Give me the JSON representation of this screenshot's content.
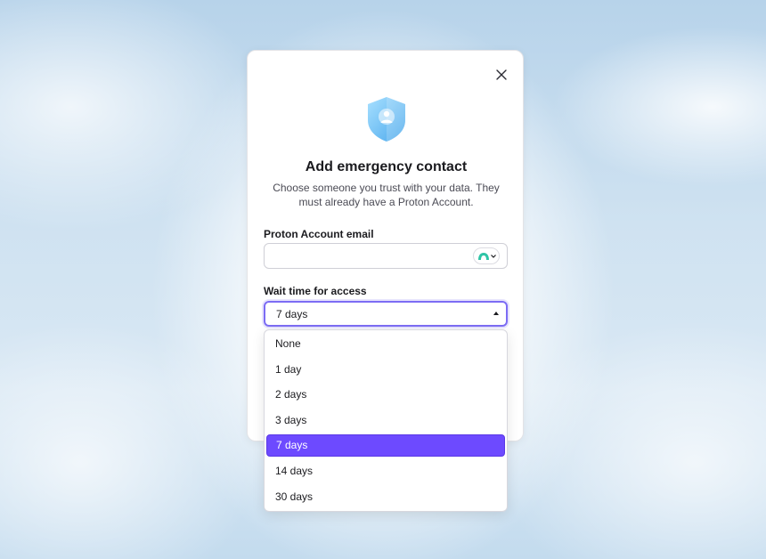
{
  "modal": {
    "title": "Add emergency contact",
    "description": "Choose someone you trust with your data. They must already have a Proton Account.",
    "email_label": "Proton Account email",
    "email_value": "",
    "email_placeholder": "",
    "wait_label": "Wait time for access",
    "wait_selected": "7 days"
  },
  "dropdown": {
    "options": [
      "None",
      "1 day",
      "2 days",
      "3 days",
      "7 days",
      "14 days",
      "30 days"
    ],
    "selected_index": 4
  },
  "icons": {
    "close": "close-icon",
    "shield": "shield-user-icon",
    "contact_picker": "contacts-icon"
  },
  "colors": {
    "accent": "#6d4aff",
    "focus_border": "#7c6cf4",
    "contact_icon": "#2ec4a6"
  }
}
